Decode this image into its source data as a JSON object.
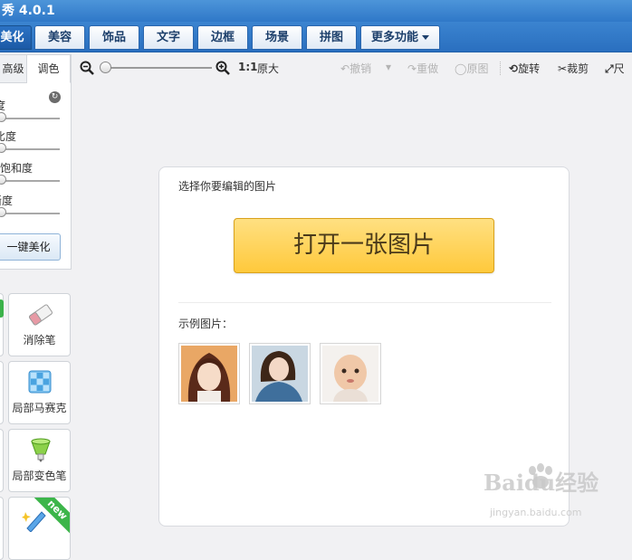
{
  "app": {
    "title": "秀 4.0.1"
  },
  "tabs": [
    {
      "label": "美化",
      "active": true
    },
    {
      "label": "美容"
    },
    {
      "label": "饰品"
    },
    {
      "label": "文字"
    },
    {
      "label": "边框"
    },
    {
      "label": "场景"
    },
    {
      "label": "拼图"
    },
    {
      "label": "更多功能",
      "has_dropdown": true
    }
  ],
  "sidebar": {
    "subtabs": [
      {
        "label": "高级",
        "active": false
      },
      {
        "label": "调色",
        "active": true
      }
    ],
    "sliders": [
      {
        "label": "亮度",
        "value": 0
      },
      {
        "label": "对比度",
        "value": 0
      },
      {
        "label": "色彩饱和度",
        "value": 0
      },
      {
        "label": "清晰度",
        "value": 0
      }
    ],
    "one_key_label": "一键美化",
    "tools": [
      {
        "label": "消除笔",
        "icon": "eraser-icon"
      },
      {
        "label": "局部马赛克",
        "icon": "mosaic-icon"
      },
      {
        "label": "局部变色笔",
        "icon": "color-brush-icon"
      },
      {
        "label": "",
        "icon": "magic-pen-icon",
        "badge": "new"
      }
    ]
  },
  "toolbar": {
    "zoom_ratio": "1:1",
    "original_size_label": "原大",
    "undo_label": "撤销",
    "redo_label": "重做",
    "original_label": "原图",
    "rotate_label": "旋转",
    "crop_label": "裁剪",
    "resize_label": "尺"
  },
  "main": {
    "prompt": "选择你要编辑的图片",
    "open_button": "打开一张图片",
    "examples_label": "示例图片：",
    "examples": [
      {
        "name": "example-photo-1"
      },
      {
        "name": "example-photo-2"
      },
      {
        "name": "example-photo-3"
      }
    ]
  },
  "watermark": {
    "brand": "Baidu经验",
    "url": "jingyan.baidu.com"
  },
  "colors": {
    "accent": "#2f78c8",
    "open_button": "#ffc93b"
  }
}
